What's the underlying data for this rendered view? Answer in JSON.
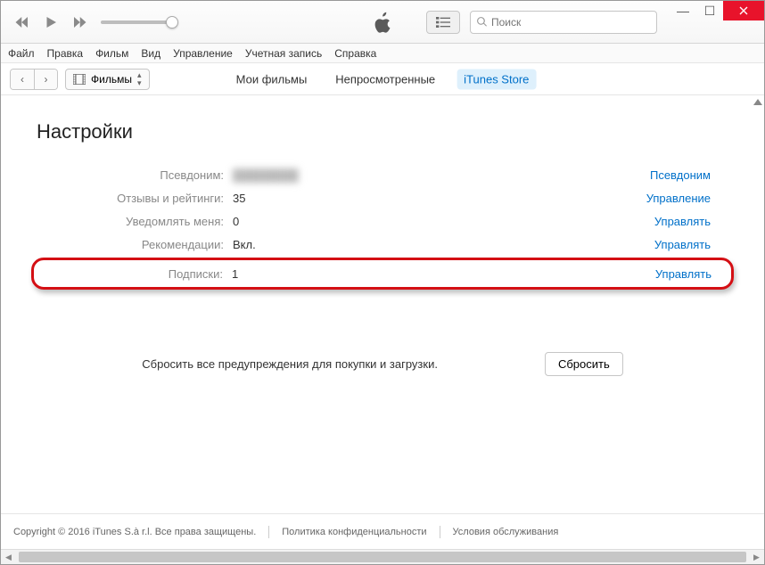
{
  "search": {
    "placeholder": "Поиск"
  },
  "menubar": [
    "Файл",
    "Правка",
    "Фильм",
    "Вид",
    "Управление",
    "Учетная запись",
    "Справка"
  ],
  "category": {
    "label": "Фильмы"
  },
  "tabs": [
    {
      "label": "Мои фильмы",
      "active": false
    },
    {
      "label": "Непросмотренные",
      "active": false
    },
    {
      "label": "iTunes Store",
      "active": true
    }
  ],
  "page": {
    "title": "Настройки"
  },
  "settings": {
    "rows": [
      {
        "label": "Псевдоним:",
        "value": "████████",
        "action": "Псевдоним",
        "blur": true
      },
      {
        "label": "Отзывы и рейтинги:",
        "value": "35",
        "action": "Управление"
      },
      {
        "label": "Уведомлять меня:",
        "value": "0",
        "action": "Управлять"
      },
      {
        "label": "Рекомендации:",
        "value": "Вкл.",
        "action": "Управлять"
      }
    ],
    "highlighted": {
      "label": "Подписки:",
      "value": "1",
      "action": "Управлять"
    }
  },
  "reset": {
    "text": "Сбросить все предупреждения для покупки и загрузки.",
    "button": "Сбросить"
  },
  "footer": {
    "copyright": "Copyright © 2016 iTunes S.à r.l. Все права защищены.",
    "privacy": "Политика конфиденциальности",
    "terms": "Условия обслуживания"
  }
}
